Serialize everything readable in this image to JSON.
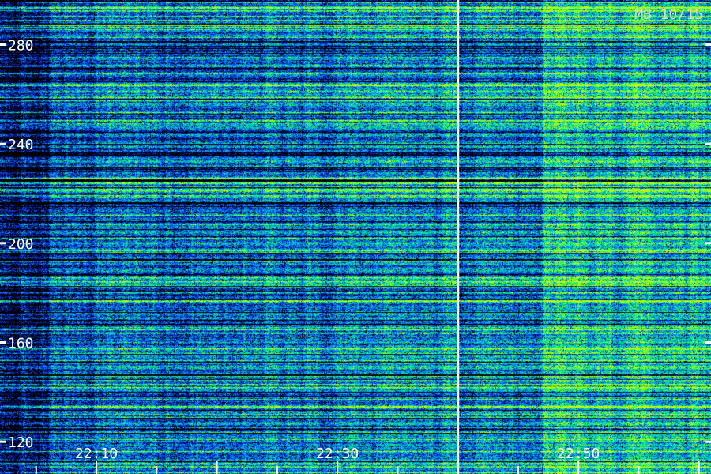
{
  "chart_data": {
    "type": "heatmap",
    "title": "MB 10/15",
    "xlabel": "",
    "ylabel": "",
    "x_ticks": [
      "22:10",
      "22:30",
      "22:50"
    ],
    "y_ticks": [
      280,
      240,
      200,
      160,
      120
    ],
    "xlim": [
      "22:02",
      "22:61"
    ],
    "ylim": [
      107,
      298
    ],
    "time_marker": "22:40",
    "colormap": [
      "#000000",
      "#00147a",
      "#0a3cff",
      "#0a8cff",
      "#00dcb4",
      "#00ff6e",
      "#c8ff00"
    ],
    "line_color": "#ffffff",
    "intensity_by_period": [
      {
        "from": "22:02",
        "to": "22:06",
        "level": 0.25
      },
      {
        "from": "22:06",
        "to": "22:10",
        "level": 0.45
      },
      {
        "from": "22:10",
        "to": "22:24",
        "level": 0.55
      },
      {
        "from": "22:24",
        "to": "22:40",
        "level": 0.62
      },
      {
        "from": "22:40",
        "to": "22:47",
        "level": 0.55
      },
      {
        "from": "22:47",
        "to": "22:49",
        "level": 0.85
      },
      {
        "from": "22:49",
        "to": "22:61",
        "level": 0.78
      }
    ]
  }
}
